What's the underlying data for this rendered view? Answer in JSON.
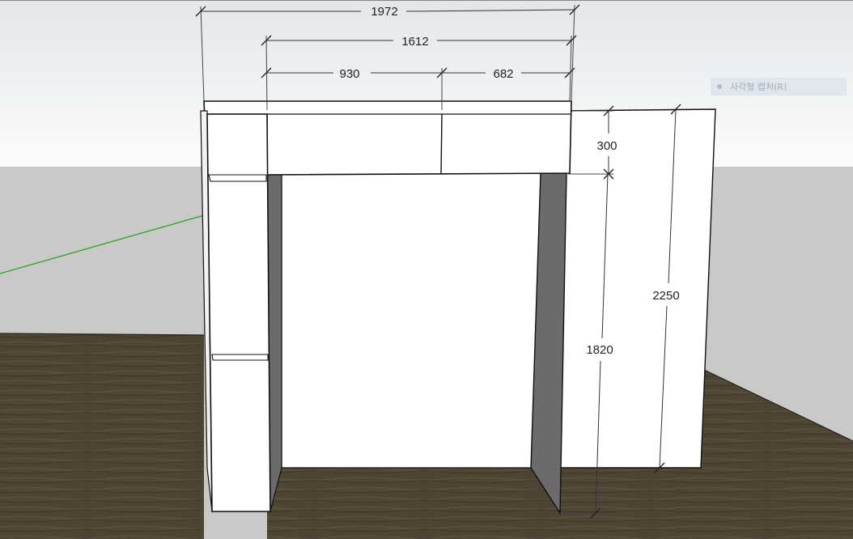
{
  "dimensions": {
    "overall_width": "1972",
    "inner_width": "1612",
    "left_section": "930",
    "right_section": "682",
    "top_height": "300",
    "opening_height": "1820",
    "total_height": "2250"
  },
  "tooltip": {
    "label": "사각형 캡처(R)"
  },
  "colors": {
    "sky_top": "#e2e6ea",
    "sky_bottom": "#ffffff",
    "ground": "#c9cac8",
    "floor": "#4f4536",
    "axis_green": "#2aa02a",
    "panel_shadow": "#6b6b6b",
    "edge": "#111111"
  }
}
